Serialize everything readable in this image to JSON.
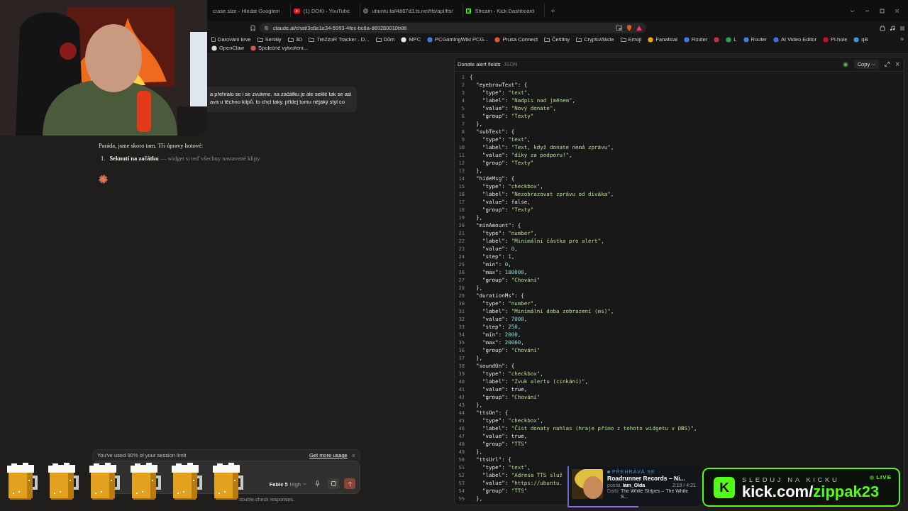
{
  "browser": {
    "tabs": [
      {
        "title": "crase size - Hledat Googlem",
        "kind": "plain"
      },
      {
        "title": "(1) DOKI - YouTube",
        "kind": "video"
      },
      {
        "title": "ubuntu.tail4867d3.ts.net/tts/api/tts/",
        "kind": "web"
      },
      {
        "title": "Stream - Kick Dashboard",
        "kind": "stream"
      }
    ],
    "new_tab": "+",
    "url": "claude.ai/chat/3c6e1e34-5993-4fec-bc6a-869260010b86",
    "bookmarks": [
      {
        "label": "Darování krve",
        "kind": "page"
      },
      {
        "label": "Seriály",
        "kind": "folder"
      },
      {
        "label": "3D",
        "kind": "folder"
      },
      {
        "label": "TreZzoR Tracker - D...",
        "kind": "folder"
      },
      {
        "label": "Dům",
        "kind": "folder"
      },
      {
        "label": "MPC",
        "kind": "site",
        "color": "#e6e6e6"
      },
      {
        "label": "PCGamingWiki PCG...",
        "kind": "site",
        "color": "#3f7fd9"
      },
      {
        "label": "Prusa Connect",
        "kind": "site",
        "color": "#e2572b"
      },
      {
        "label": "Češtiny",
        "kind": "folder"
      },
      {
        "label": "Crypto/Akcie",
        "kind": "folder"
      },
      {
        "label": "Emoji",
        "kind": "folder"
      },
      {
        "label": "Fanatical",
        "kind": "site",
        "color": "#f2a31a"
      },
      {
        "label": "Router",
        "kind": "site",
        "color": "#3d7be0"
      },
      {
        "kind": "site",
        "color": "#c0304a"
      },
      {
        "label": "L",
        "kind": "site",
        "color": "#2fa34f"
      },
      {
        "label": "Router",
        "kind": "site",
        "color": "#3d7be0"
      },
      {
        "label": "AI Video Editor",
        "kind": "site",
        "color": "#3b6fe0"
      },
      {
        "label": "Pi-hole",
        "kind": "site",
        "color": "#c8102e"
      },
      {
        "label": "qB",
        "kind": "site",
        "color": "#4a90d9"
      },
      {
        "label": "OpenClaw",
        "kind": "site",
        "color": "#dddddd"
      },
      {
        "label": "Společné vytvoření...",
        "kind": "site",
        "color": "#d9534f"
      }
    ],
    "more_bookmarks": "»"
  },
  "chat": {
    "user_message_lines": [
      "a přehralo se i se zvukme. na začátku je ale seklé tak se asi",
      "ava u těchno klipů. to chci taky. přidej tomu nějaký styl co"
    ],
    "response": {
      "intro": "Paráda, jsme skoro tam. Tři úpravy hotové:",
      "items": [
        {
          "number": "1.",
          "title": "Seknutí na začátku",
          "text": "— widget si teď všechny nastavené klipy"
        }
      ]
    },
    "usage_banner": {
      "text": "You've used 90% of your session limit",
      "link": "Get more usage",
      "close": "×"
    },
    "composer": {
      "model": "Fable 5",
      "effort": "High"
    },
    "disclaimer": "double-check responses."
  },
  "artifact": {
    "title": "Donate alert fields",
    "format": "JSON",
    "copy": "Copy",
    "close": "×",
    "lines": [
      {
        "number": "1",
        "text": "{"
      },
      {
        "number": "2",
        "text": "  \"eyebrowText\": {"
      },
      {
        "number": "3",
        "text": "    \"type\": \"text\","
      },
      {
        "number": "4",
        "text": "    \"label\": \"Nadpis nad jménem\","
      },
      {
        "number": "5",
        "text": "    \"value\": \"Nový donate\","
      },
      {
        "number": "6",
        "text": "    \"group\": \"Texty\""
      },
      {
        "number": "7",
        "text": "  },"
      },
      {
        "number": "8",
        "text": "  \"subText\": {"
      },
      {
        "number": "9",
        "text": "    \"type\": \"text\","
      },
      {
        "number": "10",
        "text": "    \"label\": \"Text, když donate nemá zprávu\","
      },
      {
        "number": "11",
        "text": "    \"value\": \"díky za podporu!\","
      },
      {
        "number": "12",
        "text": "    \"group\": \"Texty\""
      },
      {
        "number": "13",
        "text": "  },"
      },
      {
        "number": "14",
        "text": "  \"hideMsg\": {"
      },
      {
        "number": "15",
        "text": "    \"type\": \"checkbox\","
      },
      {
        "number": "16",
        "text": "    \"label\": \"Nezobrazovat zprávu od diváka\","
      },
      {
        "number": "17",
        "text": "    \"value\": false,"
      },
      {
        "number": "18",
        "text": "    \"group\": \"Texty\""
      },
      {
        "number": "19",
        "text": "  },"
      },
      {
        "number": "20",
        "text": "  \"minAmount\": {"
      },
      {
        "number": "21",
        "text": "    \"type\": \"number\","
      },
      {
        "number": "22",
        "text": "    \"label\": \"Minimální částka pro alert\","
      },
      {
        "number": "23",
        "text": "    \"value\": 0,"
      },
      {
        "number": "24",
        "text": "    \"step\": 1,"
      },
      {
        "number": "25",
        "text": "    \"min\": 0,"
      },
      {
        "number": "26",
        "text": "    \"max\": 100000,"
      },
      {
        "number": "27",
        "text": "    \"group\": \"Chování\""
      },
      {
        "number": "28",
        "text": "  },"
      },
      {
        "number": "29",
        "text": "  \"durationMs\": {"
      },
      {
        "number": "30",
        "text": "    \"type\": \"number\","
      },
      {
        "number": "31",
        "text": "    \"label\": \"Minimální doba zobrazení (ms)\","
      },
      {
        "number": "32",
        "text": "    \"value\": 7000,"
      },
      {
        "number": "33",
        "text": "    \"step\": 250,"
      },
      {
        "number": "34",
        "text": "    \"min\": 2000,"
      },
      {
        "number": "35",
        "text": "    \"max\": 20000,"
      },
      {
        "number": "36",
        "text": "    \"group\": \"Chování\""
      },
      {
        "number": "37",
        "text": "  },"
      },
      {
        "number": "38",
        "text": "  \"soundOn\": {"
      },
      {
        "number": "39",
        "text": "    \"type\": \"checkbox\","
      },
      {
        "number": "40",
        "text": "    \"label\": \"Zvuk alertu (cinkání)\","
      },
      {
        "number": "41",
        "text": "    \"value\": true,"
      },
      {
        "number": "42",
        "text": "    \"group\": \"Chování\""
      },
      {
        "number": "43",
        "text": "  },"
      },
      {
        "number": "44",
        "text": "  \"ttsOn\": {"
      },
      {
        "number": "45",
        "text": "    \"type\": \"checkbox\","
      },
      {
        "number": "46",
        "text": "    \"label\": \"Číst donaty nahlas (hraje přímo z tohoto widgetu v OBS)\","
      },
      {
        "number": "47",
        "text": "    \"value\": true,"
      },
      {
        "number": "48",
        "text": "    \"group\": \"TTS\""
      },
      {
        "number": "49",
        "text": "  },"
      },
      {
        "number": "50",
        "text": "  \"ttsUrl\": {"
      },
      {
        "number": "51",
        "text": "    \"type\": \"text\","
      },
      {
        "number": "52",
        "text": "    \"label\": \"Adresa TTS služ"
      },
      {
        "number": "53",
        "text": "    \"value\": \"https://ubuntu."
      },
      {
        "number": "54",
        "text": "    \"group\": \"TTS\""
      },
      {
        "number": "55",
        "text": "  },"
      }
    ]
  },
  "beer_mugs": [
    {
      "kind": "beer"
    },
    {
      "kind": "beer"
    },
    {
      "kind": "beer"
    },
    {
      "kind": "beer"
    },
    {
      "kind": "beer"
    },
    {
      "kind": "beer"
    }
  ],
  "now_playing": {
    "status": "PŘEHRÁVÁ SE",
    "title": "Roadrunner Records – Ni...",
    "sender_label": "posílá",
    "sender": "Iam_Olda",
    "time": "2:19 / 4:21",
    "next_label": "Další",
    "next": "The White Stripes – The White S...",
    "level": 0.53
  },
  "kick_banner": {
    "logo": "K",
    "caption": "SLEDUJ NA KICKU",
    "live": "LIVE",
    "url_prefix": "kick.com/",
    "channel": "zippak23"
  }
}
